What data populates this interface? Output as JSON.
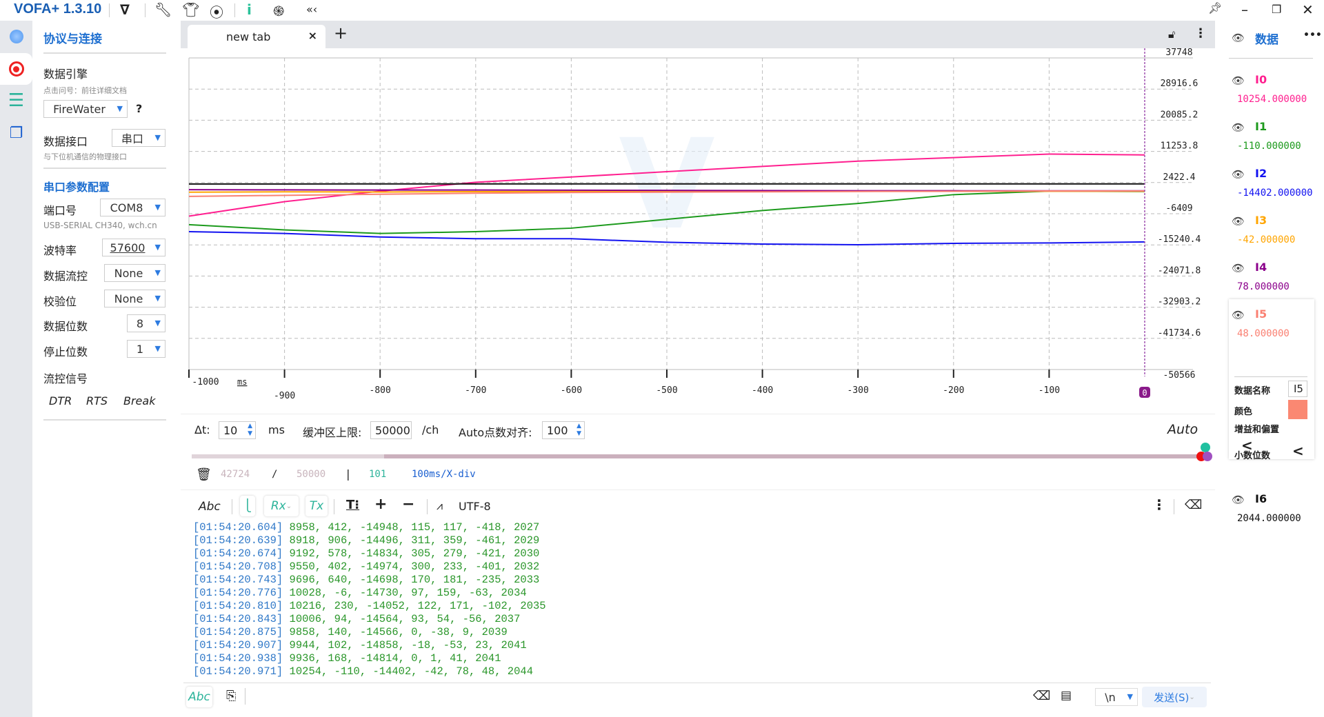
{
  "app": {
    "title": "VOFA+ 1.3.10"
  },
  "titlebar_icons": [
    "v-logo-icon",
    "wrench-icon",
    "shirt-icon",
    "screenshot-icon",
    "info-icon",
    "fingerprint-icon",
    "collapse-icon"
  ],
  "left": {
    "title": "协议与连接",
    "engine_label": "数据引擎",
    "engine_hint": "点击问号：前往详细文档",
    "engine_value": "FireWater",
    "help": "?",
    "iface_label": "数据接口",
    "iface_value": "串口",
    "iface_hint": "与下位机通信的物理接口",
    "serial_title": "串口参数配置",
    "port_label": "端口号",
    "port_value": "COM8",
    "port_hint": "USB-SERIAL CH340, wch.cn",
    "baud_label": "波特率",
    "baud_value": "57600",
    "flow_label": "数据流控",
    "flow_value": "None",
    "parity_label": "校验位",
    "parity_value": "None",
    "databits_label": "数据位数",
    "databits_value": "8",
    "stopbits_label": "停止位数",
    "stopbits_value": "1",
    "signal_label": "流控信号",
    "dtr": "DTR",
    "rts": "RTS",
    "brk": "Break"
  },
  "tabs": [
    {
      "label": "new tab",
      "close": "×"
    }
  ],
  "add_tab": "+",
  "plot": {
    "y_ticks": [
      "37748",
      "28916.6",
      "20085.2",
      "11253.8",
      "2422.4",
      "-6409",
      "-15240.4",
      "-24071.8",
      "-32903.2",
      "-41734.6",
      "-50566"
    ],
    "ylim": [
      -50566,
      37748
    ],
    "x_ticks": [
      "-1000",
      "-900",
      "-800",
      "-700",
      "-600",
      "-500",
      "-400",
      "-300",
      "-200",
      "-100"
    ],
    "x_unit": "ms",
    "cursor_label": "0",
    "xlim": [
      -1000,
      0
    ],
    "x": [
      -1000,
      -900,
      -800,
      -700,
      -600,
      -500,
      -400,
      -300,
      -200,
      -100,
      0
    ],
    "series": [
      {
        "name": "I0",
        "color": "#ff1f8f",
        "values": [
          -7100,
          -3000,
          0,
          2500,
          4000,
          5500,
          7000,
          8500,
          9500,
          10500,
          10254
        ]
      },
      {
        "name": "I1",
        "color": "#1c9a1c",
        "values": [
          -9500,
          -11000,
          -12000,
          -11500,
          -10500,
          -8000,
          -5500,
          -3500,
          -1000,
          0,
          -110
        ]
      },
      {
        "name": "I2",
        "color": "#1212f0",
        "values": [
          -11500,
          -12000,
          -13000,
          -13500,
          -13500,
          -14500,
          -15000,
          -15200,
          -14800,
          -14700,
          -14402
        ]
      },
      {
        "name": "I3",
        "color": "#ffa500",
        "values": [
          -300,
          -200,
          -250,
          -150,
          -100,
          -80,
          -60,
          -50,
          -50,
          -45,
          -42
        ]
      },
      {
        "name": "I4",
        "color": "#8b008b",
        "values": [
          400,
          350,
          300,
          300,
          250,
          200,
          150,
          120,
          100,
          90,
          78
        ]
      },
      {
        "name": "I5",
        "color": "#fa8072",
        "values": [
          -1500,
          -1200,
          -900,
          -600,
          -400,
          -300,
          -200,
          -100,
          -50,
          40,
          48
        ]
      },
      {
        "name": "I6",
        "color": "#111111",
        "values": [
          2027,
          2029,
          2030,
          2032,
          2033,
          2034,
          2035,
          2037,
          2039,
          2041,
          2044
        ]
      }
    ]
  },
  "controls": {
    "dt_label": "Δt:",
    "dt_value": "10",
    "dt_unit": "ms",
    "buf_label": "缓冲区上限:",
    "buf_value": "50000",
    "buf_unit": "/ch",
    "auto_label": "Auto点数对齐:",
    "auto_value": "100",
    "auto_mode": "Auto",
    "slider_fraction": 0.19
  },
  "stats": {
    "count": "42724",
    "slash": "/",
    "limit": "50000",
    "bar": "|",
    "points": "101",
    "xdiv": "100ms/X-div"
  },
  "toolbar": {
    "abc": "Abc",
    "rx": "Rx",
    "tx": "Tx",
    "encoding": "UTF-8"
  },
  "log": [
    [
      "[01:54:20.604]",
      "8958, 412, -14948, 115, 117, -418, 2027"
    ],
    [
      "[01:54:20.639]",
      "8918, 906, -14496, 311, 359, -461, 2029"
    ],
    [
      "[01:54:20.674]",
      "9192, 578, -14834, 305, 279, -421, 2030"
    ],
    [
      "[01:54:20.708]",
      "9550, 402, -14974, 300, 233, -401, 2032"
    ],
    [
      "[01:54:20.743]",
      "9696, 640, -14698, 170, 181, -235, 2033"
    ],
    [
      "[01:54:20.776]",
      "10028, -6, -14730, 97, 159, -63, 2034"
    ],
    [
      "[01:54:20.810]",
      "10216, 230, -14052, 122, 171, -102, 2035"
    ],
    [
      "[01:54:20.843]",
      "10006, 94, -14564, 93, 54, -56, 2037"
    ],
    [
      "[01:54:20.875]",
      "9858, 140, -14566, 0, -38, 9, 2039"
    ],
    [
      "[01:54:20.907]",
      "9944, 102, -14858, -18, -53, 23, 2041"
    ],
    [
      "[01:54:20.938]",
      "9936, 168, -14814, 0, 1, 41, 2041"
    ],
    [
      "[01:54:20.971]",
      "10254, -110, -14402, -42, 78, 48, 2044"
    ]
  ],
  "send": {
    "abc": "Abc",
    "newline": "\\n",
    "send_label": "发送(S)"
  },
  "right": {
    "title": "数据",
    "more": "•••",
    "channels": [
      {
        "name": "I0",
        "value": "10254.000000",
        "color": "#ff1f8f"
      },
      {
        "name": "I1",
        "value": "-110.000000",
        "color": "#1c9a1c"
      },
      {
        "name": "I2",
        "value": "-14402.000000",
        "color": "#1212f0"
      },
      {
        "name": "I3",
        "value": "-42.000000",
        "color": "#ffa500"
      },
      {
        "name": "I4",
        "value": "78.000000",
        "color": "#8b008b"
      },
      {
        "name": "I5",
        "value": "48.000000",
        "color": "#fa8072"
      },
      {
        "name": "I6",
        "value": "2044.000000",
        "color": "#111111"
      }
    ],
    "detail": {
      "name_label": "数据名称",
      "name_value": "I5",
      "color_label": "颜色",
      "color": "#fa8872",
      "gain_label": "增益和偏置",
      "gain_toggle": "<",
      "decimals_label": "小数位数",
      "decimals_toggle": "<"
    }
  }
}
